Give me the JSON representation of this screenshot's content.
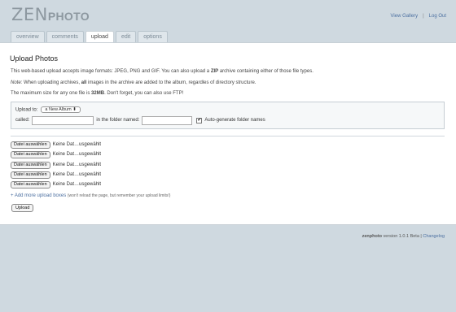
{
  "header": {
    "logo_zen": "ZEN",
    "logo_photo": "PHOTO",
    "view_gallery": "View Gallery",
    "separator": "|",
    "log_out": "Log Out"
  },
  "tabs": [
    {
      "label": "overview"
    },
    {
      "label": "comments"
    },
    {
      "label": "upload"
    },
    {
      "label": "edit"
    },
    {
      "label": "options"
    }
  ],
  "main": {
    "title": "Upload Photos",
    "p1_pre": "This web-based upload accepts image formats: JPEG, PNG and GIF. You can also upload a ",
    "p1_bold": "ZIP",
    "p1_post": " archive containing either of those file types.",
    "p2_note": "Note:",
    "p2_pre": " When uploading archives, ",
    "p2_bold": "all",
    "p2_post": " images in the archive are added to the album, regardles of directory structure.",
    "p3_pre": "The maximum size for any one file is ",
    "p3_bold": "32MB",
    "p3_post": ". Don't forget, you can also use FTP!",
    "upload_to_label": "Upload to:",
    "album_select": "a New Album",
    "called_label": "called:",
    "folder_label": "in the folder named:",
    "autogen_label": "Auto-generate folder names",
    "autogen_check": "✔",
    "file_button": "Datei auswählen",
    "file_status": "Keine Dat…usgewählt",
    "add_more_link": "+ Add more upload boxes",
    "add_more_note": "(won't reload the page, but remember your upload limits!)",
    "upload_button": "Upload"
  },
  "footer": {
    "zen": "zen",
    "photo": "photo",
    "version": " version 1.0.1 Beta",
    "sep": " | ",
    "changelog": "Changelog"
  }
}
